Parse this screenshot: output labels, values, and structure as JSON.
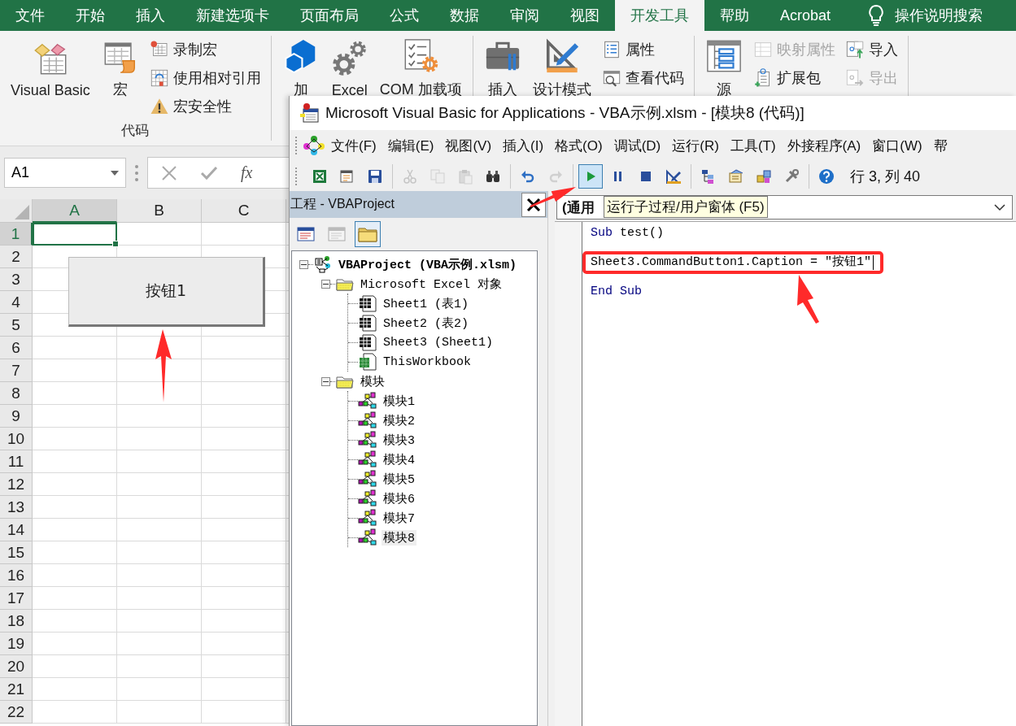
{
  "excel": {
    "tabs": [
      {
        "label": "文件",
        "selected": false
      },
      {
        "label": "开始",
        "selected": false
      },
      {
        "label": "插入",
        "selected": false
      },
      {
        "label": "新建选项卡",
        "selected": false
      },
      {
        "label": "页面布局",
        "selected": false
      },
      {
        "label": "公式",
        "selected": false
      },
      {
        "label": "数据",
        "selected": false
      },
      {
        "label": "审阅",
        "selected": false
      },
      {
        "label": "视图",
        "selected": false
      },
      {
        "label": "开发工具",
        "selected": true
      },
      {
        "label": "帮助",
        "selected": false
      },
      {
        "label": "Acrobat",
        "selected": false
      }
    ],
    "tell_me": "操作说明搜索",
    "ribbon_groups": [
      {
        "label": "代码",
        "large": [
          {
            "kind": "visual-basic",
            "label": "Visual Basic"
          },
          {
            "kind": "macro",
            "label": "宏"
          }
        ],
        "small_columns": [
          [
            {
              "kind": "record",
              "label": "录制宏",
              "disabled": false
            },
            {
              "kind": "relative",
              "label": "使用相对引用",
              "disabled": false
            },
            {
              "kind": "warning",
              "label": "宏安全性",
              "disabled": false
            }
          ]
        ]
      },
      {
        "large": [
          {
            "kind": "addin",
            "label": "加"
          },
          {
            "kind": "gears",
            "label": "Excel"
          },
          {
            "kind": "com",
            "label": "COM 加载项"
          }
        ]
      },
      {
        "large": [
          {
            "kind": "toolbox",
            "label": "插入"
          },
          {
            "kind": "design",
            "label": "设计模式"
          }
        ],
        "small_columns": [
          [
            {
              "kind": "properties",
              "label": "属性",
              "disabled": false
            },
            {
              "kind": "view-code",
              "label": "查看代码",
              "disabled": false
            }
          ]
        ]
      },
      {
        "large": [
          {
            "kind": "source",
            "label": "源"
          }
        ],
        "small_columns": [
          [
            {
              "kind": "map",
              "label": "映射属性",
              "disabled": true
            },
            {
              "kind": "expansion",
              "label": "扩展包",
              "disabled": false
            }
          ],
          [
            {
              "kind": "import",
              "label": "导入",
              "disabled": false
            },
            {
              "kind": "export",
              "label": "导出",
              "disabled": true
            }
          ]
        ]
      }
    ],
    "name_box": "A1",
    "formula_label": "fx",
    "columns": [
      {
        "label": "A",
        "selected": true
      },
      {
        "label": "B",
        "selected": false
      },
      {
        "label": "C",
        "selected": false
      }
    ],
    "rows": [
      {
        "label": "1",
        "selected": true
      },
      {
        "label": "2",
        "selected": false
      },
      {
        "label": "3",
        "selected": false
      },
      {
        "label": "4",
        "selected": false
      },
      {
        "label": "5",
        "selected": false
      },
      {
        "label": "6",
        "selected": false
      },
      {
        "label": "7",
        "selected": false
      },
      {
        "label": "8",
        "selected": false
      },
      {
        "label": "9",
        "selected": false
      },
      {
        "label": "10",
        "selected": false
      },
      {
        "label": "11",
        "selected": false
      },
      {
        "label": "12",
        "selected": false
      },
      {
        "label": "13",
        "selected": false
      },
      {
        "label": "14",
        "selected": false
      },
      {
        "label": "15",
        "selected": false
      },
      {
        "label": "16",
        "selected": false
      },
      {
        "label": "17",
        "selected": false
      },
      {
        "label": "18",
        "selected": false
      },
      {
        "label": "19",
        "selected": false
      },
      {
        "label": "20",
        "selected": false
      },
      {
        "label": "21",
        "selected": false
      },
      {
        "label": "22",
        "selected": false
      }
    ],
    "sheet_button": "按钮1"
  },
  "vba": {
    "title": "Microsoft Visual Basic for Applications - VBA示例.xlsm - [模块8 (代码)]",
    "menu": [
      "文件(F)",
      "编辑(E)",
      "视图(V)",
      "插入(I)",
      "格式(O)",
      "调试(D)",
      "运行(R)",
      "工具(T)",
      "外接程序(A)",
      "窗口(W)",
      "帮"
    ],
    "toolbar_groups": [
      [
        {
          "kind": "excel",
          "disabled": false,
          "hovered": false
        },
        {
          "kind": "userform",
          "disabled": false,
          "hovered": false
        },
        {
          "kind": "save",
          "disabled": false,
          "hovered": false
        }
      ],
      [
        {
          "kind": "cut",
          "disabled": true,
          "hovered": false
        },
        {
          "kind": "copy",
          "disabled": true,
          "hovered": false
        },
        {
          "kind": "paste",
          "disabled": true,
          "hovered": false
        },
        {
          "kind": "find",
          "disabled": false,
          "hovered": false
        }
      ],
      [
        {
          "kind": "undo",
          "disabled": false,
          "hovered": false
        },
        {
          "kind": "redo",
          "disabled": true,
          "hovered": false
        }
      ],
      [
        {
          "kind": "run",
          "disabled": false,
          "hovered": true
        },
        {
          "kind": "pause",
          "disabled": false,
          "hovered": false
        },
        {
          "kind": "stop",
          "disabled": false,
          "hovered": false
        },
        {
          "kind": "design",
          "disabled": false,
          "hovered": false
        }
      ],
      [
        {
          "kind": "project",
          "disabled": false,
          "hovered": false
        },
        {
          "kind": "properties",
          "disabled": false,
          "hovered": false
        },
        {
          "kind": "browser",
          "disabled": false,
          "hovered": false
        },
        {
          "kind": "toolbox",
          "disabled": false,
          "hovered": false
        }
      ],
      [
        {
          "kind": "help",
          "disabled": false,
          "hovered": false
        }
      ]
    ],
    "cursor_position": "行 3, 列 40",
    "project_pane": {
      "title": "工程 - VBAProject",
      "tools": [
        {
          "kind": "view-code",
          "selected": false
        },
        {
          "kind": "view-object",
          "selected": false
        },
        {
          "kind": "folders",
          "selected": true
        }
      ],
      "tree": [
        {
          "kind": "project",
          "label": "VBAProject (VBA示例.xlsm)",
          "expanded": true,
          "selected": false,
          "children": [
            {
              "kind": "folder",
              "label": "Microsoft Excel 对象",
              "expanded": true,
              "selected": false,
              "children": [
                {
                  "kind": "sheet",
                  "label": "Sheet1 (表1)",
                  "selected": false
                },
                {
                  "kind": "sheet",
                  "label": "Sheet2 (表2)",
                  "selected": false
                },
                {
                  "kind": "sheet",
                  "label": "Sheet3 (Sheet1)",
                  "selected": false
                },
                {
                  "kind": "workbook",
                  "label": "ThisWorkbook",
                  "selected": false
                }
              ]
            },
            {
              "kind": "folder",
              "label": "模块",
              "expanded": true,
              "selected": false,
              "children": [
                {
                  "kind": "module",
                  "label": "模块1",
                  "selected": false
                },
                {
                  "kind": "module",
                  "label": "模块2",
                  "selected": false
                },
                {
                  "kind": "module",
                  "label": "模块3",
                  "selected": false
                },
                {
                  "kind": "module",
                  "label": "模块4",
                  "selected": false
                },
                {
                  "kind": "module",
                  "label": "模块5",
                  "selected": false
                },
                {
                  "kind": "module",
                  "label": "模块6",
                  "selected": false
                },
                {
                  "kind": "module",
                  "label": "模块7",
                  "selected": false
                },
                {
                  "kind": "module",
                  "label": "模块8",
                  "selected": true
                }
              ]
            }
          ]
        }
      ]
    },
    "code_pane": {
      "object_dropdown": "(通用",
      "tooltip": "运行子过程/用户窗体 (F5)",
      "lines": [
        {
          "highlighted": false,
          "cursor": false,
          "tokens": [
            {
              "kind": "keyword",
              "text": "Sub"
            },
            {
              "kind": "plain",
              "text": " test()"
            }
          ]
        },
        {
          "highlighted": true,
          "cursor": true,
          "tokens": [
            {
              "kind": "plain",
              "text": "Sheet3.CommandButton1.Caption = \"按钮1\""
            }
          ]
        },
        {
          "highlighted": false,
          "cursor": false,
          "tokens": [
            {
              "kind": "keyword",
              "text": "End Sub"
            }
          ]
        }
      ]
    }
  }
}
